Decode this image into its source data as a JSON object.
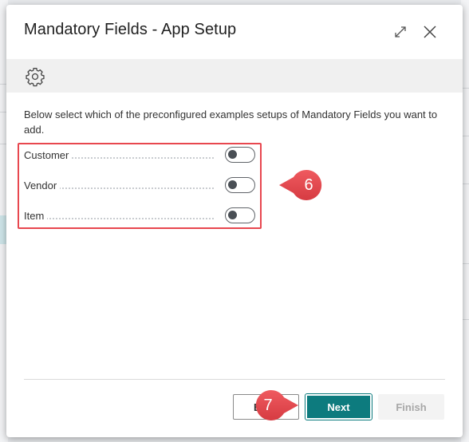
{
  "dialog": {
    "title": "Mandatory Fields - App Setup",
    "expand_icon": "expand-icon",
    "close_icon": "close-icon"
  },
  "action_bar": {
    "icon": "gear-icon"
  },
  "instructions": "Below select which of the preconfigured examples setups of Mandatory Fields you want to add.",
  "fields": [
    {
      "label": "Customer",
      "enabled": false
    },
    {
      "label": "Vendor",
      "enabled": false
    },
    {
      "label": "Item",
      "enabled": false
    }
  ],
  "callouts": {
    "step_fields": "6",
    "step_next": "7"
  },
  "buttons": {
    "back": "Back",
    "next": "Next",
    "finish": "Finish"
  },
  "colors": {
    "accent": "#0d7b7e",
    "callout": "#e8474f"
  }
}
